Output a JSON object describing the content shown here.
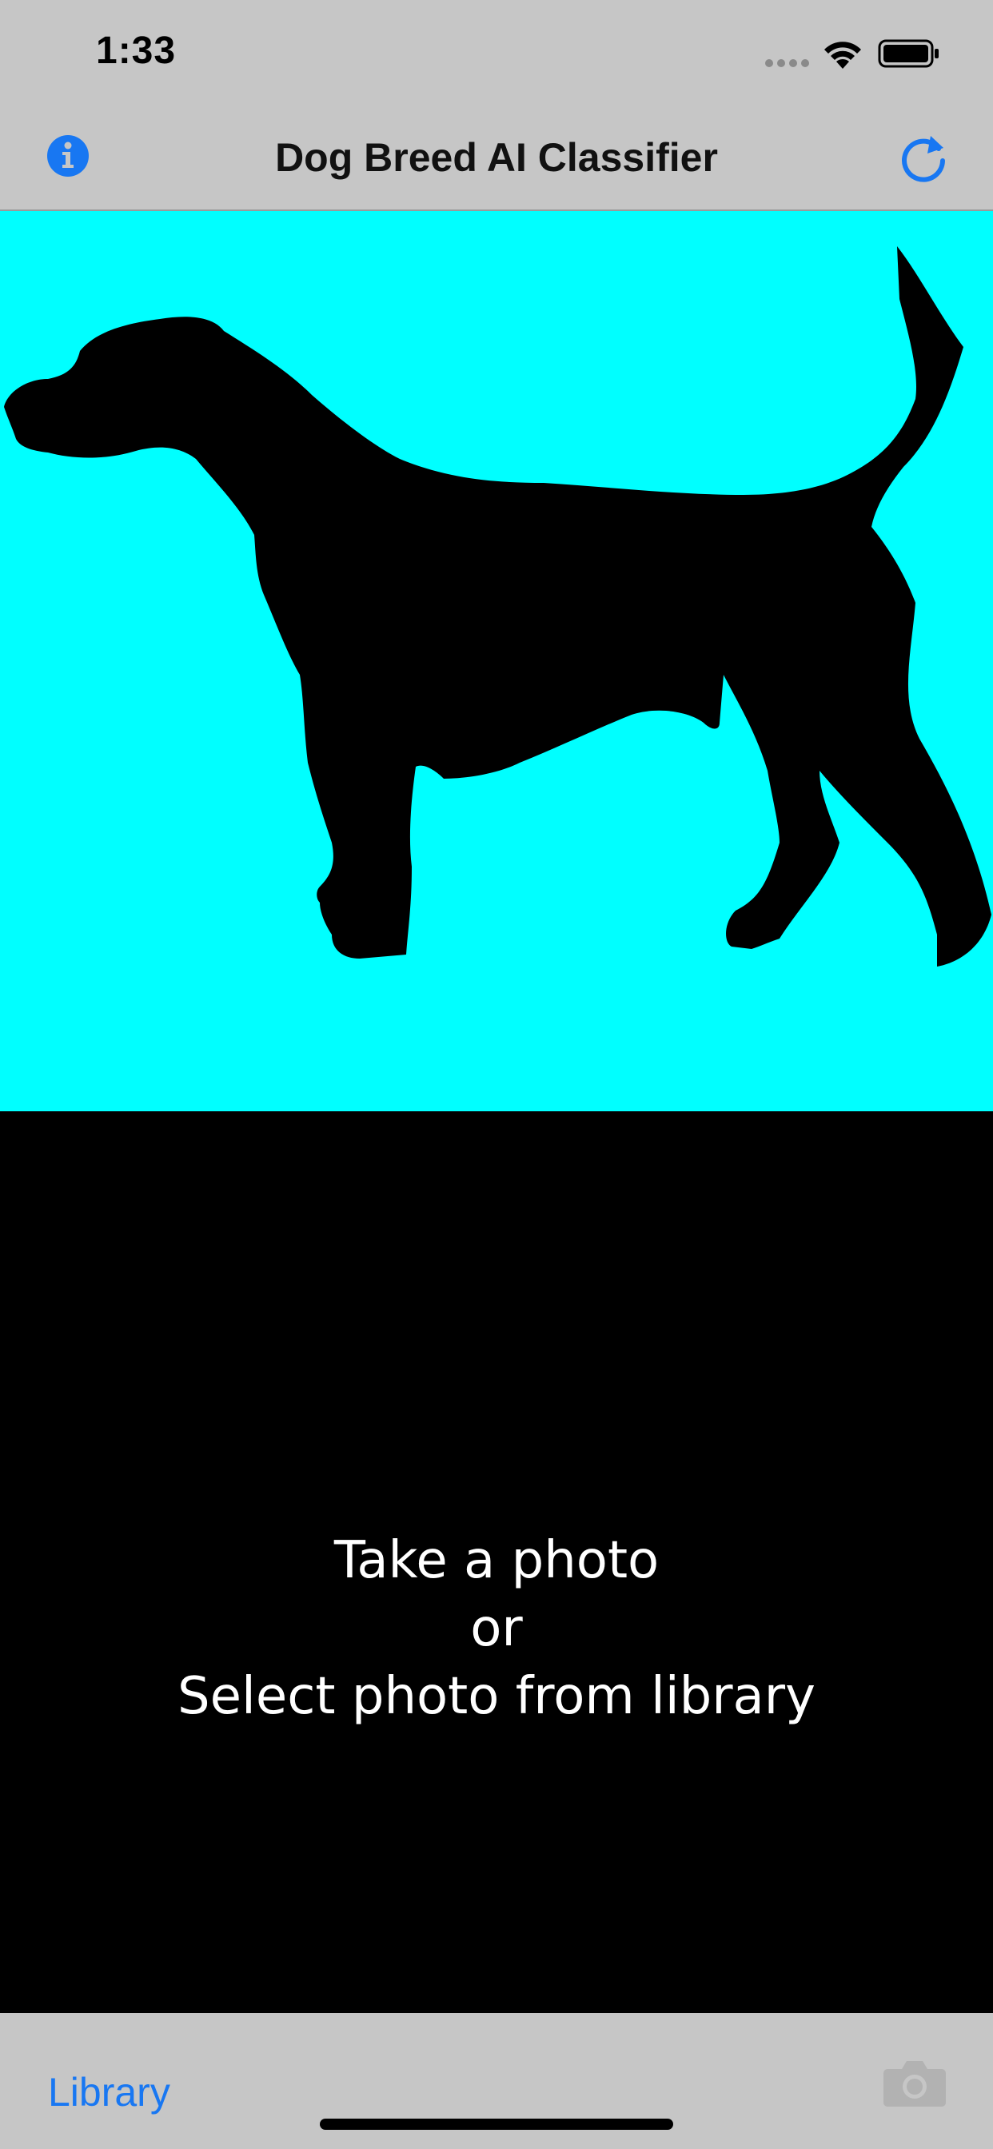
{
  "status_bar": {
    "time": "1:33",
    "icons": [
      "cellular-dots-icon",
      "wifi-icon",
      "battery-icon"
    ]
  },
  "nav": {
    "title": "Dog Breed AI Classifier",
    "left_icon": "info-icon",
    "right_icon": "refresh-icon"
  },
  "photo": {
    "background_color": "#00ffff",
    "content": "dog-silhouette"
  },
  "result": {
    "line1": "Take a photo",
    "line2": "or",
    "line3": "Select photo from library"
  },
  "toolbar": {
    "library_label": "Library",
    "camera_icon": "camera-icon"
  },
  "colors": {
    "accent": "#1877f2",
    "bar_background": "#c6c6c6",
    "photo_background": "#00ffff",
    "result_background": "#000000",
    "result_text": "#ffffff"
  }
}
